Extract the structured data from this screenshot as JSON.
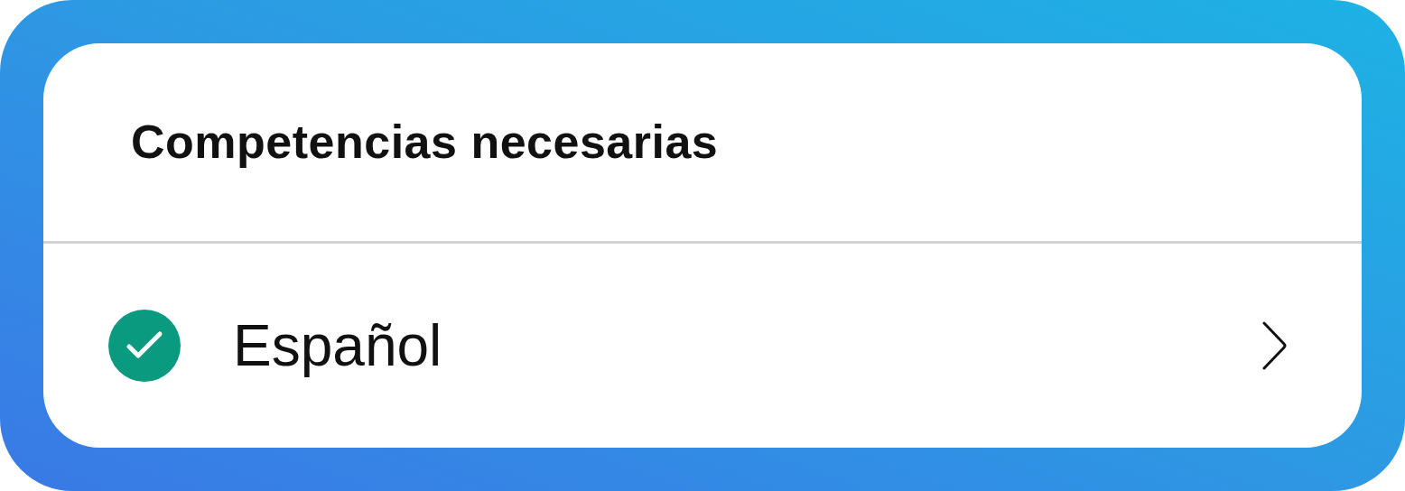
{
  "title": "Competencias necesarias",
  "items": [
    {
      "label": "Español",
      "checked": true
    }
  ]
}
